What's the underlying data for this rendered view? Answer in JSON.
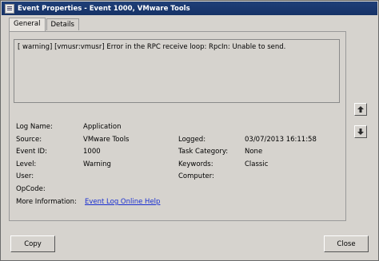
{
  "window": {
    "title": "Event Properties - Event 1000, VMware Tools"
  },
  "tabs": [
    {
      "label": "General",
      "active": true
    },
    {
      "label": "Details",
      "active": false
    }
  ],
  "event": {
    "message": "[ warning] [vmusr:vmusr] Error in the RPC receive loop: RpcIn: Unable to send.",
    "fields_left": [
      {
        "label": "Log Name:",
        "value": "Application"
      },
      {
        "label": "Source:",
        "value": "VMware Tools"
      },
      {
        "label": "Event ID:",
        "value": "1000"
      },
      {
        "label": "Level:",
        "value": "Warning"
      },
      {
        "label": "User:",
        "value": ""
      },
      {
        "label": "OpCode:",
        "value": ""
      },
      {
        "label": "More Information:",
        "value": "Event Log Online Help"
      }
    ],
    "fields_right": [
      {
        "label": "Logged:",
        "value": "03/07/2013 16:11:58"
      },
      {
        "label": "Task Category:",
        "value": "None"
      },
      {
        "label": "Keywords:",
        "value": "Classic"
      },
      {
        "label": "Computer:",
        "value": ""
      }
    ]
  },
  "buttons": {
    "copy": "Copy",
    "close": "Close"
  },
  "icons": {
    "up": "arrow-up-icon",
    "down": "arrow-down-icon"
  }
}
